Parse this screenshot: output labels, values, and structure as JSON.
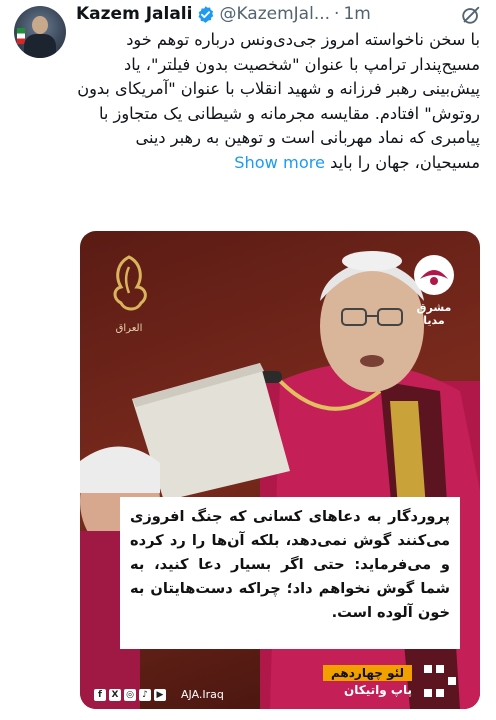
{
  "author": {
    "name": "Kazem Jalali",
    "handle": "@KazemJal...",
    "separator": "·",
    "time": "1m"
  },
  "tweet": {
    "text": "با سخن ناخواسته امروز جی‌دی‌ونس درباره توهم خود مسیح‌پندار ترامپ با عنوان \"شخصیت بدون فیلتر\"، یاد پیش‌بینی رهبر فرزانه و شهید انقلاب با عنوان \"آمریکای بدون روتوش\" افتادم. مقایسه مجرمانه و شیطانی یک متجاوز با پیامبری که نماد مهربانی است و توهین به رهبر دینی مسیحیان، جهان را باید ",
    "show_more": "Show more"
  },
  "media": {
    "logo_left_subtext": "العراق",
    "logo_right_line1": "مشرق",
    "logo_right_line2": "مدیا",
    "quote": "پروردگار به دعاهای کسانی که جنگ افروزی می‌کنند گوش نمی‌دهد، بلکه آن‌ها را رد کرده و می‌فرماید: حتی اگر بسیار دعا کنید، به شما گوش نخواهم داد؛ چراکه دست‌هایتان به خون آلوده است.",
    "source_name": "لئو چهاردهم",
    "source_title": "پاپ واتیکان",
    "social_icons": [
      "f",
      "X",
      "◎",
      "♪",
      "▶"
    ],
    "social_handle": "AJA.Iraq"
  },
  "colors": {
    "link": "#1d9bf0",
    "secondary_text": "#536471",
    "tag_orange": "#f2a000"
  },
  "icons": [
    "verified-badge-icon",
    "grok-icon",
    "mashregh-logo-icon",
    "aljazeera-logo-icon"
  ]
}
